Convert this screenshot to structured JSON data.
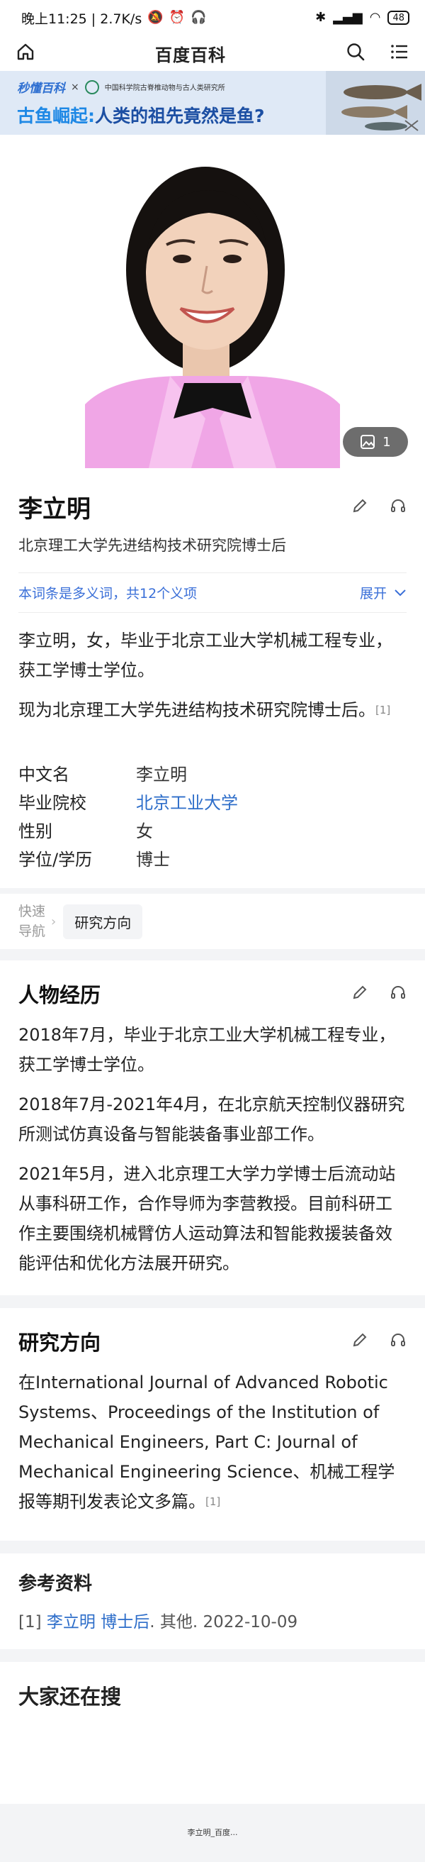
{
  "status_bar": {
    "time_speed": "晚上11:25 | 2.7K/s",
    "battery": "48"
  },
  "nav": {
    "title": "百度百科"
  },
  "banner": {
    "brand": "秒懂百科",
    "cross": "×",
    "partner": "中国科学院古脊椎动物与古人类研究所",
    "headline_a": "古鱼崛起:",
    "headline_b": "人类的祖先竟然是鱼?"
  },
  "album": {
    "count": "1"
  },
  "entry": {
    "name": "李立明",
    "subtitle": "北京理工大学先进结构技术研究院博士后",
    "polysemy": "本词条是多义词，共12个义项",
    "expand": "展开"
  },
  "summary": {
    "p1": "李立明，女，毕业于北京工业大学机械工程专业，获工学博士学位。",
    "p2": "现为北京理工大学先进结构技术研究院博士后。",
    "p2_ref": "[1]"
  },
  "infobox": {
    "rows": [
      {
        "key": "中文名",
        "value": "李立明"
      },
      {
        "key": "毕业院校",
        "value": "北京工业大学"
      },
      {
        "key": "性别",
        "value": "女"
      },
      {
        "key": "学位/学历",
        "value": "博士"
      }
    ]
  },
  "quicknav": {
    "label": "快速导航",
    "chip": "研究方向"
  },
  "experience": {
    "title": "人物经历",
    "p1": "2018年7月，毕业于北京工业大学机械工程专业，获工学博士学位。",
    "p2": "2018年7月-2021年4月，在北京航天控制仪器研究所测试仿真设备与智能装备事业部工作。",
    "p3": "2021年5月，进入北京理工大学力学博士后流动站从事科研工作，合作导师为李营教授。目前科研工作主要围绕机械臂仿人运动算法和智能救援装备效能评估和优化方法展开研究。"
  },
  "research": {
    "title": "研究方向",
    "p1": "在International Journal of Advanced Robotic Systems、Proceedings of the Institution of Mechanical Engineers, Part C: Journal of Mechanical Engineering Science、机械工程学报等期刊发表论文多篇。",
    "p1_ref": "[1]"
  },
  "references": {
    "title": "参考资料",
    "num": "[1]",
    "link": "李立明 博士后",
    "rest": ". 其他. 2022-10-09"
  },
  "also_search": {
    "title": "大家还在搜"
  },
  "footer": {
    "text": "李立明_百度..."
  }
}
